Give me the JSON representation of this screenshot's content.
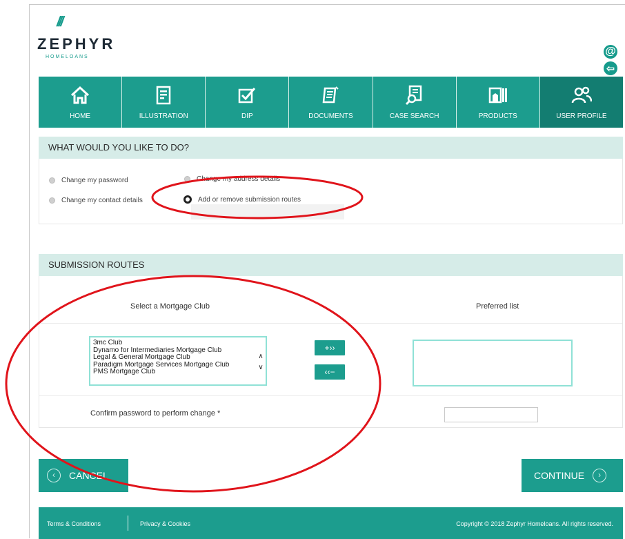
{
  "header": {
    "brand_marks": "///",
    "brand_name": "ZEPHYR",
    "brand_sub": "HOMELOANS",
    "icons": [
      "at-icon",
      "logout-icon"
    ]
  },
  "nav": {
    "items": [
      {
        "label": "HOME",
        "icon": "home-icon"
      },
      {
        "label": "ILLUSTRATION",
        "icon": "illustration-icon"
      },
      {
        "label": "DIP",
        "icon": "dip-icon"
      },
      {
        "label": "DOCUMENTS",
        "icon": "documents-icon"
      },
      {
        "label": "CASE SEARCH",
        "icon": "case-search-icon"
      },
      {
        "label": "PRODUCTS",
        "icon": "products-icon"
      },
      {
        "label": "USER PROFILE",
        "icon": "user-profile-icon"
      }
    ],
    "active": "USER PROFILE"
  },
  "what_to_do": {
    "title": "WHAT WOULD YOU LIKE TO DO?",
    "options": [
      {
        "label": "Change my password",
        "selected": false
      },
      {
        "label": "Change my address details",
        "selected": false
      },
      {
        "label": "Change my contact details",
        "selected": false
      },
      {
        "label": "Add or remove submission routes",
        "selected": true
      }
    ]
  },
  "submission_routes": {
    "title": "SUBMISSION ROUTES",
    "select_label": "Select a Mortgage Club",
    "preferred_label": "Preferred list",
    "clubs": [
      "3mc Club",
      "Dynamo for Intermediaries Mortgage Club",
      "Legal & General Mortgage Club",
      "Paradigm Mortgage Services Mortgage Club",
      "PMS Mortgage Club"
    ],
    "add_button": "+››",
    "remove_button": "‹‹−",
    "confirm_label": "Confirm password to perform change *",
    "confirm_value": ""
  },
  "actions": {
    "cancel": "CANCEL",
    "continue": "CONTINUE"
  },
  "footer": {
    "terms": "Terms & Conditions",
    "privacy": "Privacy & Cookies",
    "copyright": "Copyright © 2018 Zephyr Homeloans. All rights reserved."
  },
  "colors": {
    "primary": "#1c9d8e",
    "primary_dark": "#137d71",
    "section_bg": "#d6ece8",
    "list_border": "#8fe1d6",
    "annotation_red": "#e0141b"
  }
}
